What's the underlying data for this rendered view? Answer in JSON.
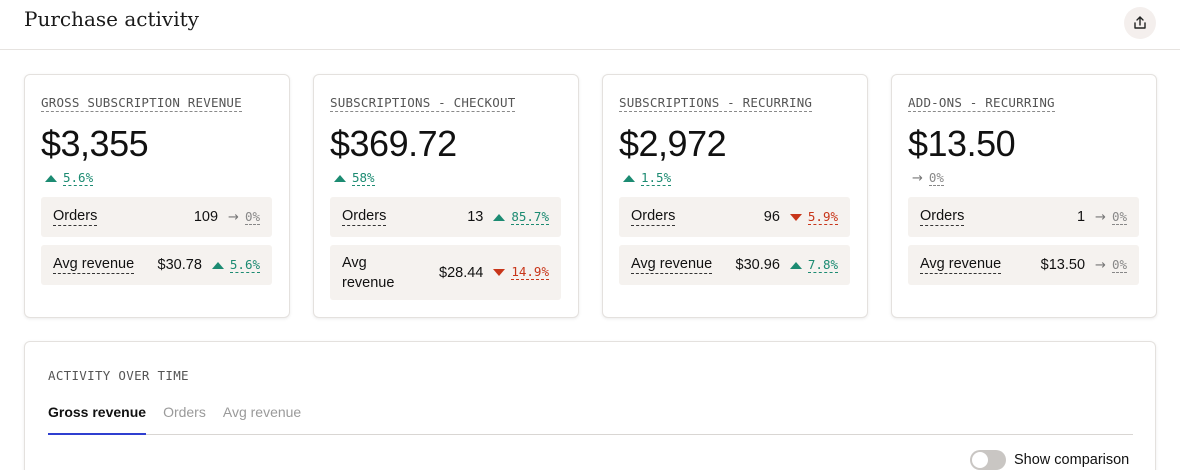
{
  "header": {
    "title": "Purchase activity",
    "export_icon": "share-upload-icon"
  },
  "cards": [
    {
      "title": "GROSS SUBSCRIPTION REVENUE",
      "value": "$3,355",
      "delta": {
        "direction": "up",
        "pct": "5.6%"
      },
      "rows": [
        {
          "label": "Orders",
          "value": "109",
          "delta": {
            "direction": "flat",
            "pct": "0%"
          }
        },
        {
          "label": "Avg revenue",
          "value": "$30.78",
          "delta": {
            "direction": "up",
            "pct": "5.6%"
          }
        }
      ]
    },
    {
      "title": "SUBSCRIPTIONS - CHECKOUT",
      "value": "$369.72",
      "delta": {
        "direction": "up",
        "pct": "58%"
      },
      "rows": [
        {
          "label": "Orders",
          "value": "13",
          "delta": {
            "direction": "up",
            "pct": "85.7%"
          }
        },
        {
          "label": "Avg revenue",
          "value": "$28.44",
          "delta": {
            "direction": "down",
            "pct": "14.9%"
          }
        }
      ]
    },
    {
      "title": "SUBSCRIPTIONS - RECURRING",
      "value": "$2,972",
      "delta": {
        "direction": "up",
        "pct": "1.5%"
      },
      "rows": [
        {
          "label": "Orders",
          "value": "96",
          "delta": {
            "direction": "down",
            "pct": "5.9%"
          }
        },
        {
          "label": "Avg revenue",
          "value": "$30.96",
          "delta": {
            "direction": "up",
            "pct": "7.8%"
          }
        }
      ]
    },
    {
      "title": "ADD-ONS - RECURRING",
      "value": "$13.50",
      "delta": {
        "direction": "flat",
        "pct": "0%"
      },
      "rows": [
        {
          "label": "Orders",
          "value": "1",
          "delta": {
            "direction": "flat",
            "pct": "0%"
          }
        },
        {
          "label": "Avg revenue",
          "value": "$13.50",
          "delta": {
            "direction": "flat",
            "pct": "0%"
          }
        }
      ]
    }
  ],
  "activity": {
    "title": "ACTIVITY OVER TIME",
    "tabs": [
      {
        "label": "Gross revenue",
        "active": true
      },
      {
        "label": "Orders",
        "active": false
      },
      {
        "label": "Avg revenue",
        "active": false
      }
    ],
    "comparison_label": "Show comparison",
    "comparison_on": false
  },
  "colors": {
    "positive": "#1c8b72",
    "negative": "#c8361a",
    "neutral": "#888888",
    "tab_active": "#2f3fd0"
  }
}
